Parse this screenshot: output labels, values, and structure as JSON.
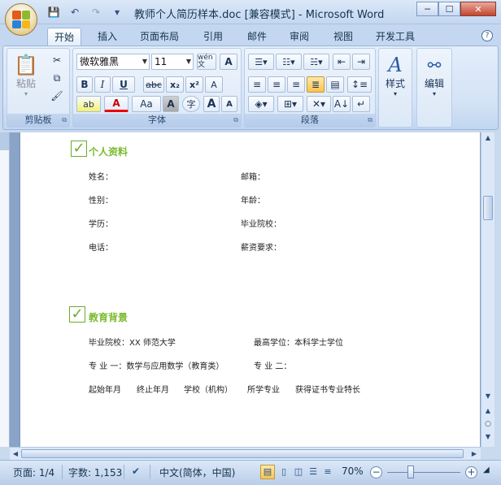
{
  "window": {
    "title": "教师个人简历样本.doc [兼容模式] - Microsoft Word",
    "minimize": "─",
    "maximize": "☐",
    "close": "✕"
  },
  "qat": {
    "save": "💾",
    "undo": "↶",
    "redo": "↷",
    "customize": "▾"
  },
  "tabs": [
    {
      "label": "开始",
      "active": true
    },
    {
      "label": "插入"
    },
    {
      "label": "页面布局"
    },
    {
      "label": "引用"
    },
    {
      "label": "邮件"
    },
    {
      "label": "审阅"
    },
    {
      "label": "视图"
    },
    {
      "label": "开发工具"
    }
  ],
  "help": "?",
  "ribbon": {
    "clipboard": {
      "label": "剪贴板",
      "paste": "粘贴",
      "cut_icon": "✂",
      "copy_icon": "⧉",
      "format_painter_icon": "🖌"
    },
    "font": {
      "label": "字体",
      "font_name": "微软雅黑",
      "font_size": "11",
      "phonetic": "wén 文",
      "char_border": "A",
      "bold": "B",
      "italic": "I",
      "underline": "U",
      "strike": "abc",
      "subscript": "x₂",
      "superscript": "x²",
      "clear_format": "A",
      "highlight": "ab",
      "font_color": "A",
      "change_case": "Aa",
      "char_shading": "A",
      "enclose": "字",
      "grow": "A",
      "shrink": "A"
    },
    "paragraph": {
      "label": "段落"
    },
    "styles": {
      "label": "样式"
    },
    "editing": {
      "label": "编辑"
    }
  },
  "document": {
    "section1": {
      "title": "个人资料",
      "fields": [
        {
          "label": "姓名："
        },
        {
          "label": "邮箱："
        },
        {
          "label": "性别："
        },
        {
          "label": "年龄："
        },
        {
          "label": "学历："
        },
        {
          "label": "毕业院校："
        },
        {
          "label": "电话："
        },
        {
          "label": "薪资要求："
        }
      ]
    },
    "section2": {
      "title": "教育背景",
      "school": "毕业院校：XX 师范大学",
      "degree": "最高学位：本科学士学位",
      "major1": "专 业 一：数学与应用数学（教育类）",
      "major2": "专 业 二：",
      "headers": [
        "起始年月",
        "终止年月",
        "学校（机构）",
        "所学专业",
        "获得证书专业特长"
      ]
    }
  },
  "statusbar": {
    "page": "页面: 1/4",
    "words": "字数: 1,153",
    "language": "中文(简体，中国)",
    "zoom": "70%",
    "zoom_percent": 70,
    "zoom_out": "−",
    "zoom_in": "+"
  }
}
